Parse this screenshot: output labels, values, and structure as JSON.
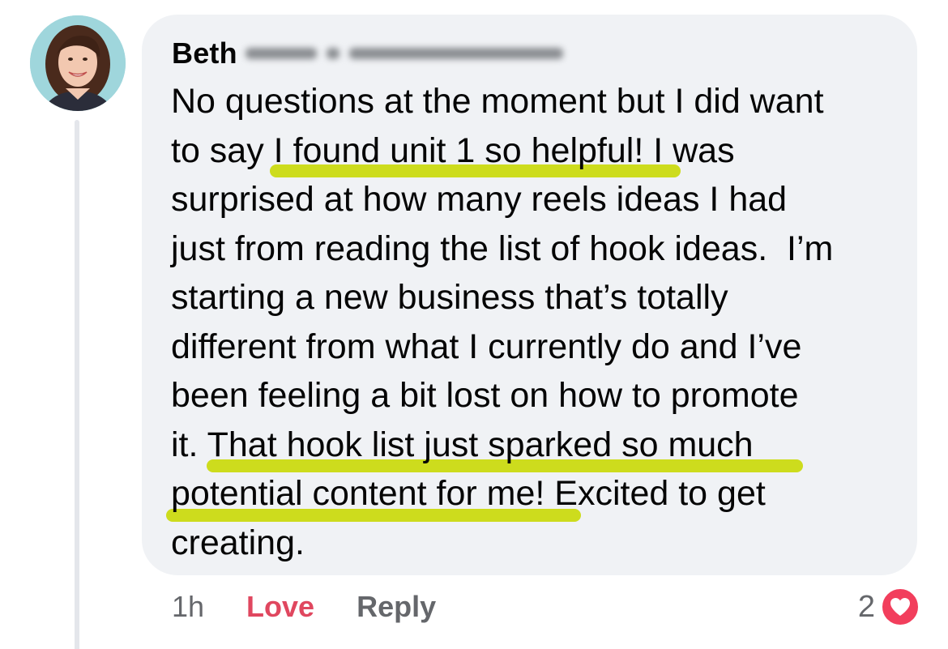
{
  "comment": {
    "author_first_name": "Beth",
    "body_lines": [
      "No questions at the moment but I did want",
      "to say I found unit 1 so helpful! I was",
      "surprised at how many reels ideas I had",
      "just from reading the list of hook ideas.  I’m",
      "starting a new business that’s totally",
      "different from what I currently do and I’ve",
      "been feeling a bit lost on how to promote",
      "it. That hook list just sparked so much",
      "potential content for me! Excited to get",
      "creating."
    ],
    "highlighted_phrases": [
      "I found unit 1 so helpful!",
      "That hook list just sparked so much potential content for me!"
    ],
    "highlight_color": "#cddc1d"
  },
  "actions": {
    "timestamp": "1h",
    "love_label": "Love",
    "reply_label": "Reply",
    "love_color": "#e0475f"
  },
  "reactions": {
    "count": "2",
    "icon": "heart-icon",
    "badge_color": "#f23e5c"
  },
  "colors": {
    "bubble": "#f0f2f5",
    "text": "#050505",
    "secondary_text": "#65676b"
  }
}
